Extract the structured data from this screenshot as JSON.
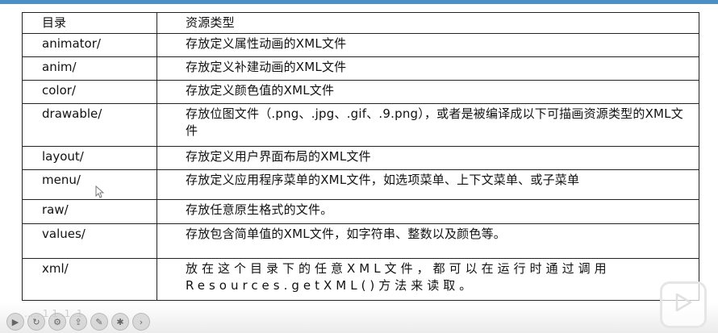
{
  "table": {
    "header": {
      "col1": "目录",
      "col2": "资源类型"
    },
    "rows": [
      {
        "dir": "animator/",
        "type": "存放定义属性动画的XML文件"
      },
      {
        "dir": "anim/",
        "type": "存放定义补建动画的XML文件"
      },
      {
        "dir": "color/",
        "type": "存放定义颜色值的XML文件"
      },
      {
        "dir": "drawable/",
        "type": "存放位图文件（.png、.jpg、.gif、.9.png），或者是被编译成以下可描画资源类型的XML文件"
      },
      {
        "dir": "layout/",
        "type": "存放定义用户界面布局的XML文件"
      },
      {
        "dir": "menu/",
        "type": "存放定义应用程序菜单的XML文件，如选项菜单、上下文菜单、或子菜单"
      },
      {
        "dir": "raw/",
        "type": "存放任意原生格式的文件。"
      },
      {
        "dir": "values/",
        "type": "存放包含简单值的XML文件，如字符串、整数以及颜色等。"
      },
      {
        "dir": "xml/",
        "type": "放在这个目录下的任意XML文件，都可以在运行时通过调用Resources.getXML()方法来读取。"
      }
    ]
  },
  "overlay": {
    "bottom_text": "..... 1 1 .1 .1",
    "icons": [
      "play-circle-icon",
      "refresh-icon",
      "settings-icon",
      "share-icon",
      "edit-icon",
      "gear-icon",
      "next-icon"
    ],
    "play_button_icon": "play-icon"
  },
  "colors": {
    "topbar": "#4a90c7",
    "border": "#222222"
  }
}
